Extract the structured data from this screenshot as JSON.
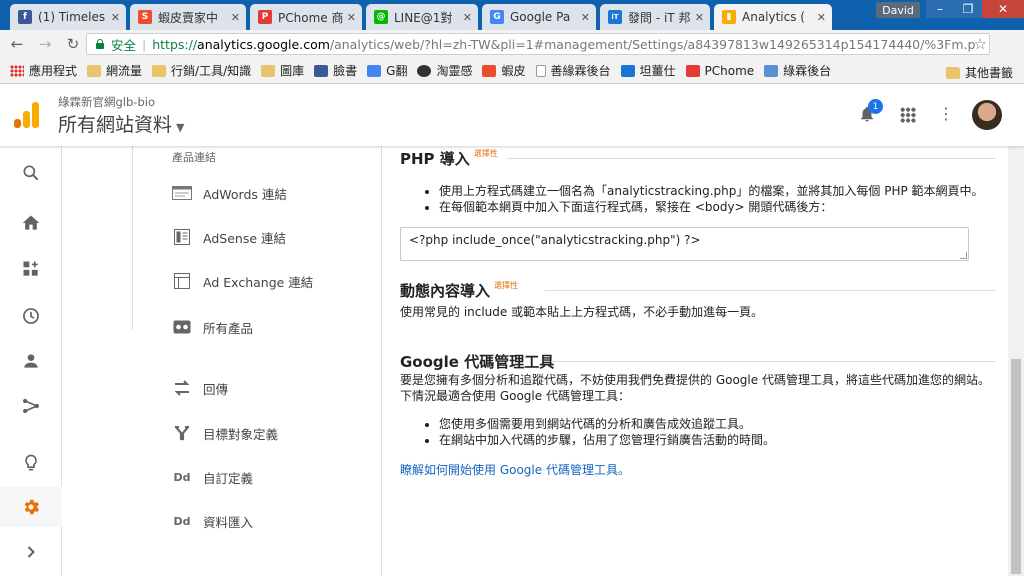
{
  "browser": {
    "tabs": [
      {
        "title": "(1) Timeles",
        "favicon_color": "#3b5998",
        "favicon_glyph": "f"
      },
      {
        "title": "蝦皮賣家中",
        "favicon_color": "#ee4d2d",
        "favicon_glyph": "S"
      },
      {
        "title": "PChome 商",
        "favicon_color": "#e53935",
        "favicon_glyph": "P"
      },
      {
        "title": "LINE@1對",
        "favicon_color": "#00b900",
        "favicon_glyph": "@"
      },
      {
        "title": "Google Pa",
        "favicon_color": "#4285f4",
        "favicon_glyph": "G"
      },
      {
        "title": "發問 - iT 邦",
        "favicon_color": "#1976d2",
        "favicon_glyph": "iT"
      },
      {
        "title": "Analytics (",
        "favicon_color": "#f9ab00",
        "favicon_glyph": "▮"
      }
    ],
    "profile_name": "David",
    "secure_label": "安全",
    "url_scheme": "https://",
    "url_host": "analytics.google.com",
    "url_path": "/analytics/web/?hl=zh-TW&pli=1#management/Settings/a84397813w149265314p154174440/%3Fm.p"
  },
  "bookmarks": {
    "items": [
      {
        "label": "應用程式",
        "icon": "apps-grid-icon"
      },
      {
        "label": "網流量",
        "icon": "folder-icon"
      },
      {
        "label": "行銷/工具/知識",
        "icon": "folder-icon"
      },
      {
        "label": "圖庫",
        "icon": "folder-icon"
      },
      {
        "label": "臉書",
        "icon": "facebook-icon"
      },
      {
        "label": "G翻",
        "icon": "translate-icon"
      },
      {
        "label": "淘靈感",
        "icon": "taobao-icon"
      },
      {
        "label": "蝦皮",
        "icon": "shopee-icon"
      },
      {
        "label": "善緣霖後台",
        "icon": "page-icon"
      },
      {
        "label": "坦薑仕",
        "icon": "w-icon"
      },
      {
        "label": "PChome",
        "icon": "pchome-icon"
      },
      {
        "label": "綠霖後台",
        "icon": "puzzle-icon"
      }
    ],
    "other_label": "其他書籤"
  },
  "header": {
    "account": "綠霖新官網glb-bio",
    "property": "所有網站資料",
    "notification_count": "1"
  },
  "admin_column": {
    "section_label": "產品連結",
    "items": [
      {
        "label": "AdWords 連結",
        "icon": "adwords-link-icon"
      },
      {
        "label": "AdSense 連結",
        "icon": "adsense-link-icon"
      },
      {
        "label": "Ad Exchange 連結",
        "icon": "ad-exchange-link-icon"
      },
      {
        "label": "所有產品",
        "icon": "all-products-icon"
      },
      {
        "label": "回傳",
        "icon": "postbacks-icon"
      },
      {
        "label": "目標對象定義",
        "icon": "audience-definitions-icon"
      },
      {
        "label": "自訂定義",
        "icon": "custom-definitions-icon",
        "glyph": "Dd"
      },
      {
        "label": "資料匯入",
        "icon": "data-import-icon",
        "glyph": "Dd"
      }
    ]
  },
  "content": {
    "php": {
      "heading": "PHP 導入",
      "optional": "選擇性",
      "bullets": [
        "使用上方程式碼建立一個名為「analyticstracking.php」的檔案，並將其加入每個 PHP 範本網頁中。",
        "在每個範本網頁中加入下面這行程式碼，緊接在 <body> 開頭代碼後方："
      ],
      "code": "<?php include_once(\"analyticstracking.php\") ?>"
    },
    "dynamic": {
      "heading": "動態內容導入",
      "optional": "選擇性",
      "text": "使用常見的 include 或範本貼上上方程式碼，不必手動加進每一頁。"
    },
    "gtm": {
      "heading": "Google 代碼管理工具",
      "text1": "要是您擁有多個分析和追蹤代碼，不妨使用我們免費提供的 Google 代碼管理工具，將這些代碼加進您的網站。",
      "text2": "下情況最適合使用 Google 代碼管理工具：",
      "bullets": [
        "您使用多個需要用到網站代碼的分析和廣告成效追蹤工具。",
        "在網站中加入代碼的步驟，佔用了您管理行銷廣告活動的時間。"
      ],
      "link": "瞭解如何開始使用 Google 代碼管理工具。"
    }
  },
  "colors": {
    "chrome_frame": "#0f61ad",
    "ga_orange": "#f9ab00",
    "accent_orange": "#e8710a",
    "link_blue": "#1565c0",
    "secure_green": "#0b8043"
  }
}
